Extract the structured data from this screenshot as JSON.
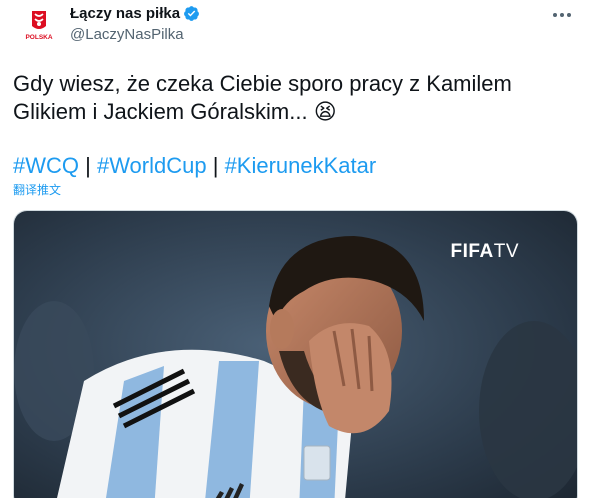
{
  "author": {
    "display_name": "Łączy nas piłka",
    "handle": "@LaczyNasPilka",
    "avatar_label": "POLSKA"
  },
  "tweet": {
    "text": "Gdy wiesz, że czeka Ciebie sporo pracy z Kamilem Glikiem i Jackiem Góralskim... 😫",
    "hashtags": [
      "#WCQ",
      "#WorldCup",
      "#KierunekKatar"
    ],
    "separator": " | ",
    "translate_label": "翻译推文"
  },
  "media": {
    "watermark_main": "FIFA",
    "watermark_suffix": "TV"
  },
  "colors": {
    "link": "#1d9bf0",
    "text": "#0f1419",
    "secondary": "#536471",
    "shirt_blue": "#8fb8e0"
  }
}
